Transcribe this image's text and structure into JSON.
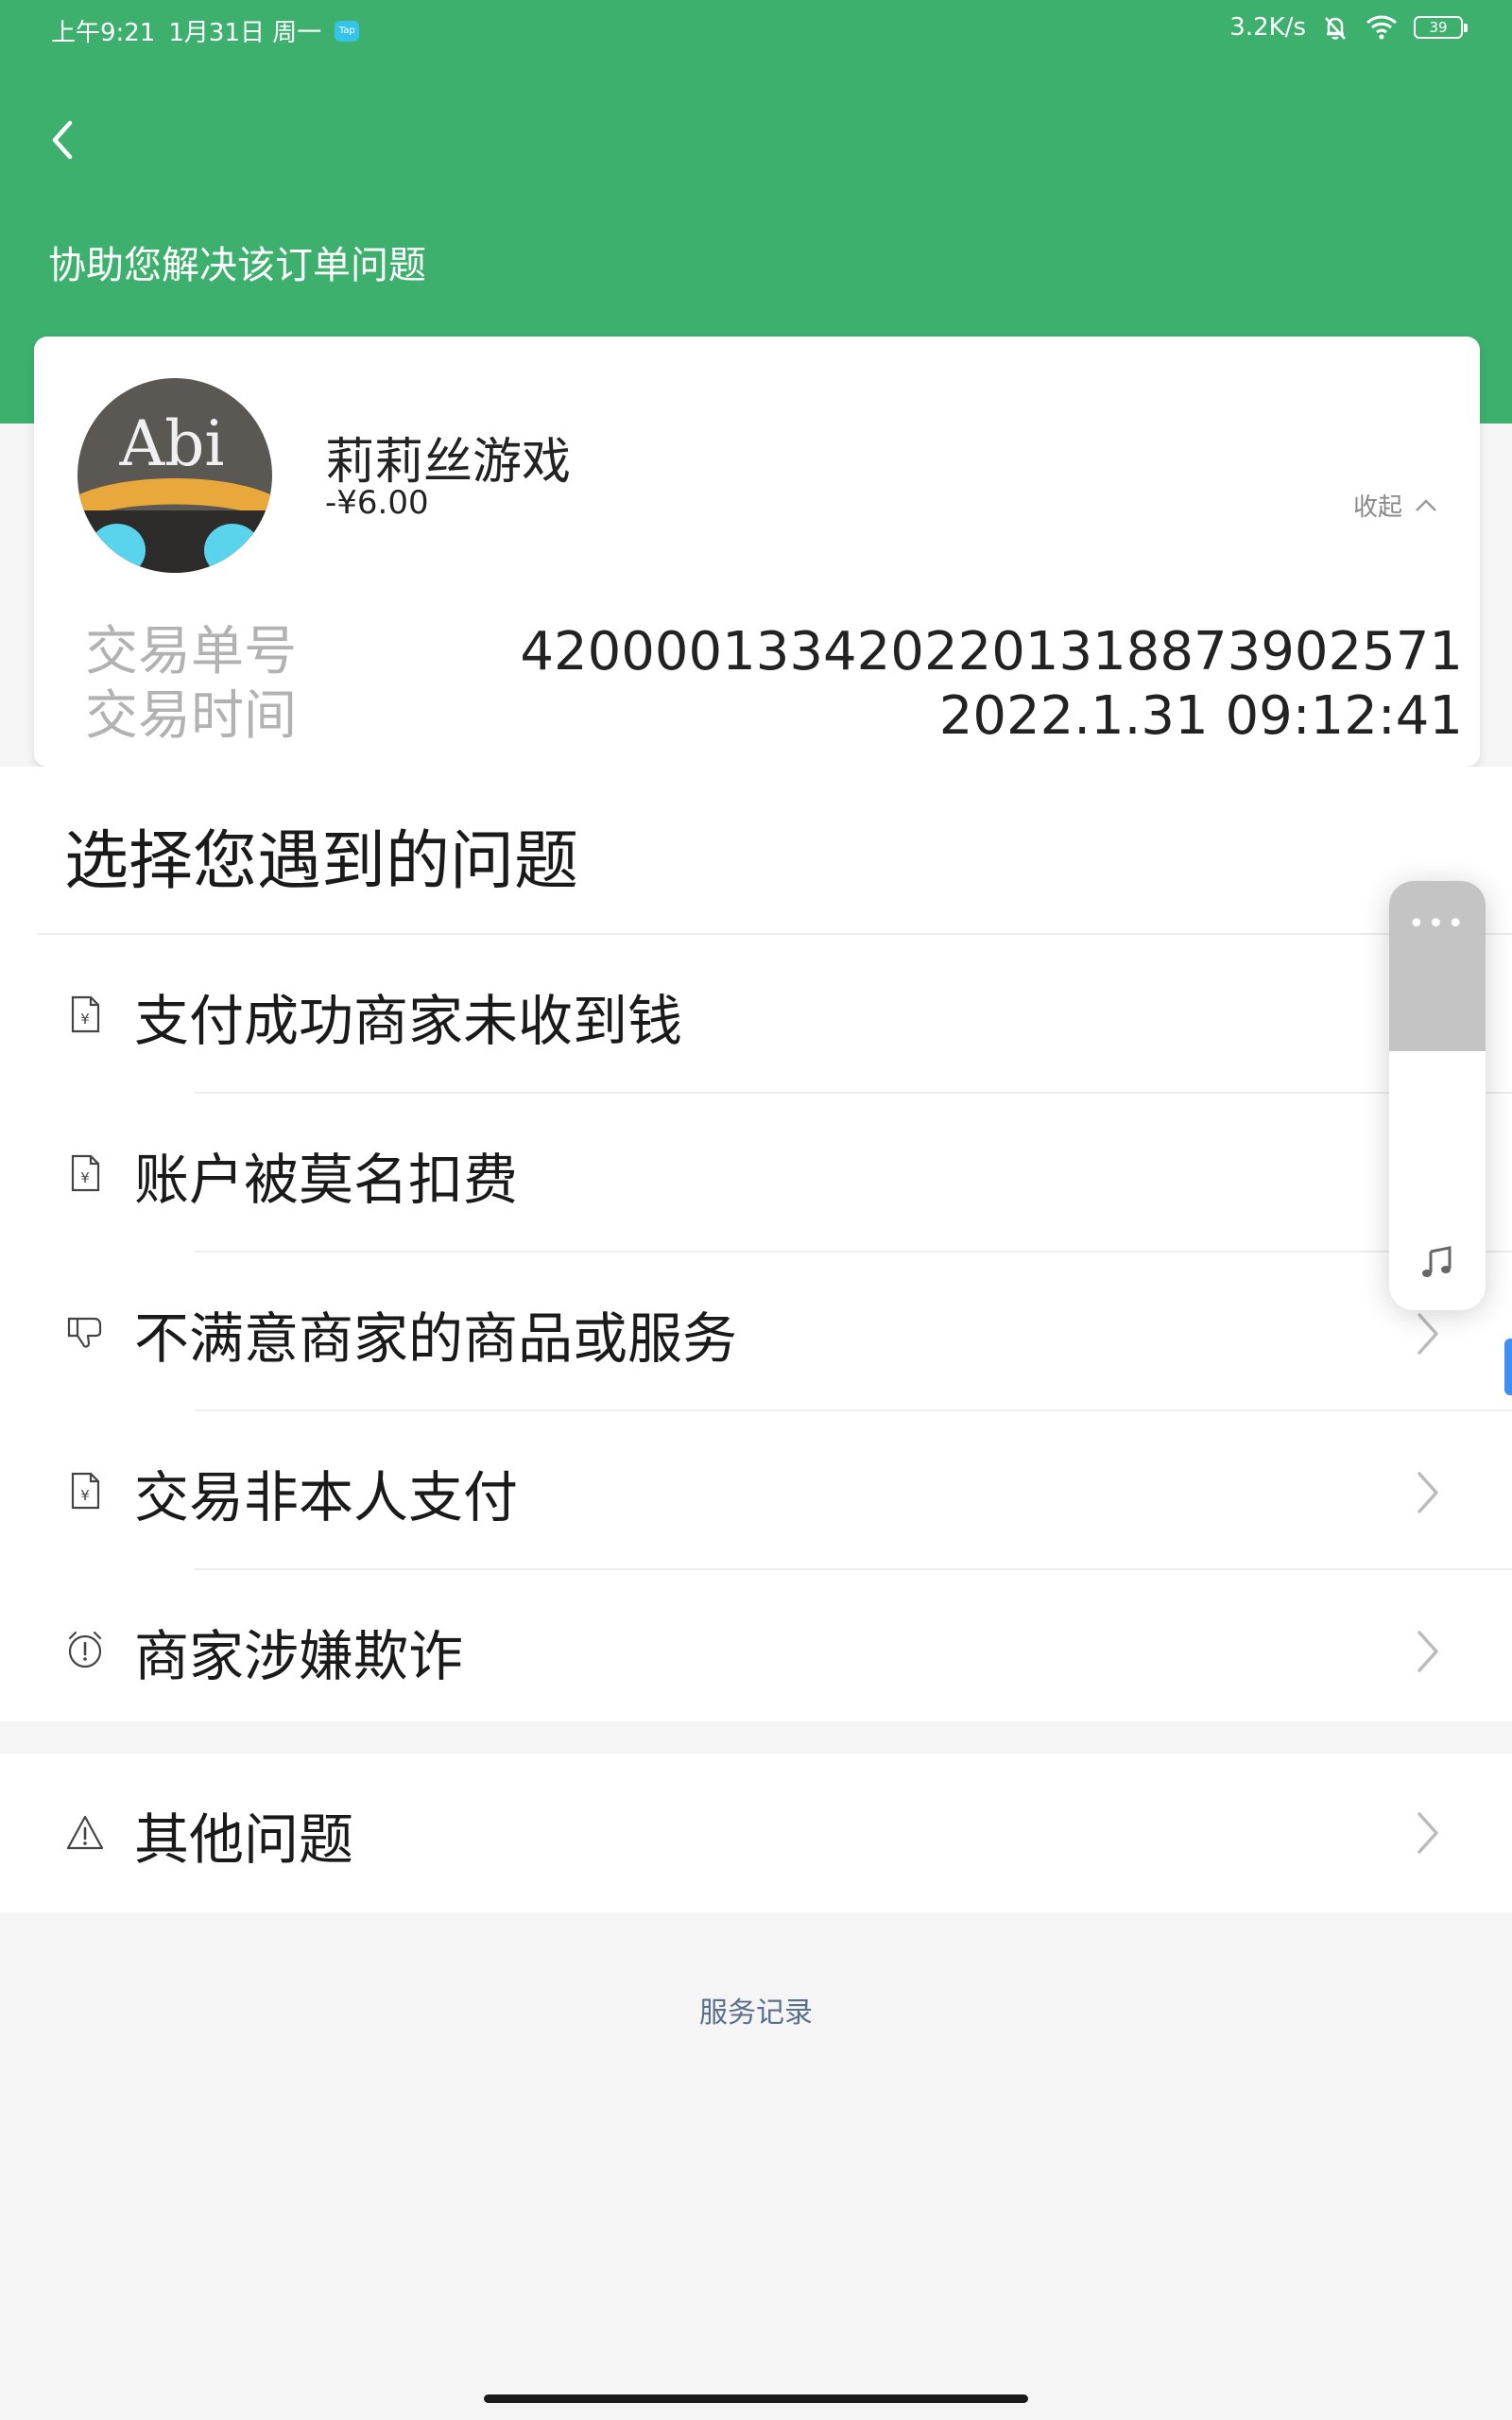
{
  "status_bar": {
    "time": "上午9:21",
    "date": "1月31日 周一",
    "app_badge": "Tap",
    "network_speed": "3.2K/s",
    "battery": "39"
  },
  "header": {
    "title": "协助您解决该订单问题"
  },
  "order": {
    "merchant_name": "莉莉丝游戏",
    "amount": "-¥6.00",
    "avatar_text": "Abi",
    "collapse_label": "收起",
    "transaction_no_label": "交易单号",
    "transaction_no": "4200001334202201318873902571",
    "transaction_time_label": "交易时间",
    "transaction_time": "2022.1.31 09:12:41"
  },
  "problems": {
    "title": "选择您遇到的问题",
    "items": [
      {
        "label": "支付成功商家未收到钱",
        "icon": "receipt-icon"
      },
      {
        "label": "账户被莫名扣费",
        "icon": "receipt-icon"
      },
      {
        "label": "不满意商家的商品或服务",
        "icon": "thumbs-down-icon"
      },
      {
        "label": "交易非本人支付",
        "icon": "receipt-icon"
      },
      {
        "label": "商家涉嫌欺诈",
        "icon": "alarm-icon"
      }
    ],
    "other": {
      "label": "其他问题",
      "icon": "warning-icon"
    }
  },
  "footer": {
    "service_record": "服务记录"
  },
  "floating_panel": {
    "menu_glyph": "•••"
  },
  "colors": {
    "brand_green": "#3eb06e",
    "link_blue": "#5a6e8e"
  }
}
